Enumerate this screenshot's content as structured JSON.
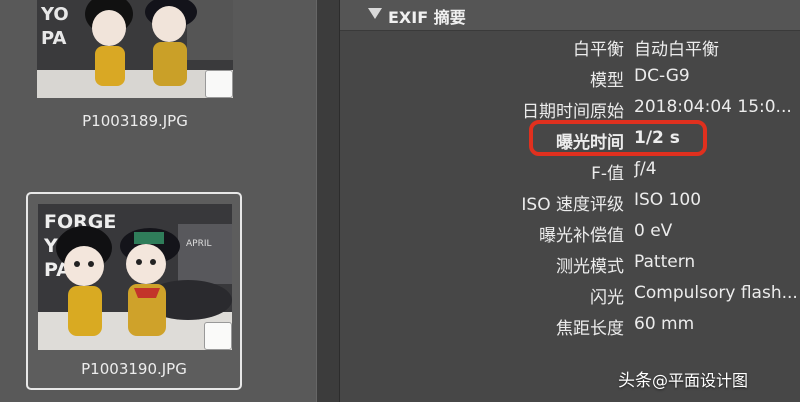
{
  "browser": {
    "thumbnails": [
      {
        "filename": "P1003189.JPG",
        "selected": false
      },
      {
        "filename": "P1003190.JPG",
        "selected": true
      }
    ],
    "photo_text": {
      "line1": "FORGE",
      "line2": "YOU",
      "line3": "PA",
      "calendar": "APRIL"
    }
  },
  "exif": {
    "section_title": "EXIF 摘要",
    "rows": [
      {
        "label": "白平衡",
        "value": "自动白平衡"
      },
      {
        "label": "模型",
        "value": "DC-G9"
      },
      {
        "label": "日期时间原始",
        "value": "2018:04:04 15:0..."
      },
      {
        "label": "曝光时间",
        "value": "1/2 s"
      },
      {
        "label": "F-值",
        "value": "ƒ/4"
      },
      {
        "label": "ISO 速度评级",
        "value": "ISO 100"
      },
      {
        "label": "曝光补偿值",
        "value": "0 eV"
      },
      {
        "label": "测光模式",
        "value": "Pattern"
      },
      {
        "label": "闪光",
        "value": "Compulsory flash..."
      },
      {
        "label": "焦距长度",
        "value": "60 mm"
      }
    ]
  },
  "watermark": {
    "prefix": "头条",
    "text": "@平面设计图"
  },
  "colors": {
    "highlight": "#e0301e",
    "panel": "#474747",
    "sidebar": "#595959"
  }
}
